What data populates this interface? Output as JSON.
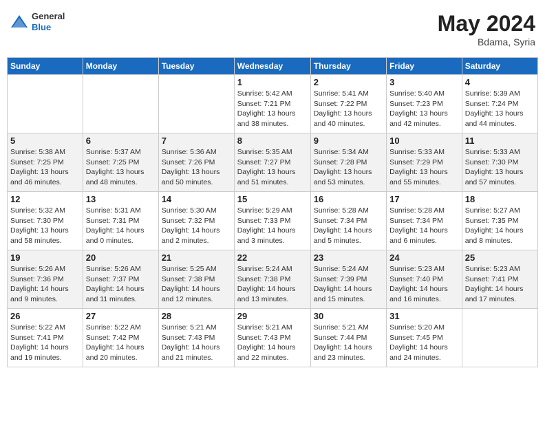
{
  "header": {
    "logo_general": "General",
    "logo_blue": "Blue",
    "title": "May 2024",
    "location": "Bdama, Syria"
  },
  "days_of_week": [
    "Sunday",
    "Monday",
    "Tuesday",
    "Wednesday",
    "Thursday",
    "Friday",
    "Saturday"
  ],
  "weeks": [
    [
      {
        "day": "",
        "info": ""
      },
      {
        "day": "",
        "info": ""
      },
      {
        "day": "",
        "info": ""
      },
      {
        "day": "1",
        "info": "Sunrise: 5:42 AM\nSunset: 7:21 PM\nDaylight: 13 hours\nand 38 minutes."
      },
      {
        "day": "2",
        "info": "Sunrise: 5:41 AM\nSunset: 7:22 PM\nDaylight: 13 hours\nand 40 minutes."
      },
      {
        "day": "3",
        "info": "Sunrise: 5:40 AM\nSunset: 7:23 PM\nDaylight: 13 hours\nand 42 minutes."
      },
      {
        "day": "4",
        "info": "Sunrise: 5:39 AM\nSunset: 7:24 PM\nDaylight: 13 hours\nand 44 minutes."
      }
    ],
    [
      {
        "day": "5",
        "info": "Sunrise: 5:38 AM\nSunset: 7:25 PM\nDaylight: 13 hours\nand 46 minutes."
      },
      {
        "day": "6",
        "info": "Sunrise: 5:37 AM\nSunset: 7:25 PM\nDaylight: 13 hours\nand 48 minutes."
      },
      {
        "day": "7",
        "info": "Sunrise: 5:36 AM\nSunset: 7:26 PM\nDaylight: 13 hours\nand 50 minutes."
      },
      {
        "day": "8",
        "info": "Sunrise: 5:35 AM\nSunset: 7:27 PM\nDaylight: 13 hours\nand 51 minutes."
      },
      {
        "day": "9",
        "info": "Sunrise: 5:34 AM\nSunset: 7:28 PM\nDaylight: 13 hours\nand 53 minutes."
      },
      {
        "day": "10",
        "info": "Sunrise: 5:33 AM\nSunset: 7:29 PM\nDaylight: 13 hours\nand 55 minutes."
      },
      {
        "day": "11",
        "info": "Sunrise: 5:33 AM\nSunset: 7:30 PM\nDaylight: 13 hours\nand 57 minutes."
      }
    ],
    [
      {
        "day": "12",
        "info": "Sunrise: 5:32 AM\nSunset: 7:30 PM\nDaylight: 13 hours\nand 58 minutes."
      },
      {
        "day": "13",
        "info": "Sunrise: 5:31 AM\nSunset: 7:31 PM\nDaylight: 14 hours\nand 0 minutes."
      },
      {
        "day": "14",
        "info": "Sunrise: 5:30 AM\nSunset: 7:32 PM\nDaylight: 14 hours\nand 2 minutes."
      },
      {
        "day": "15",
        "info": "Sunrise: 5:29 AM\nSunset: 7:33 PM\nDaylight: 14 hours\nand 3 minutes."
      },
      {
        "day": "16",
        "info": "Sunrise: 5:28 AM\nSunset: 7:34 PM\nDaylight: 14 hours\nand 5 minutes."
      },
      {
        "day": "17",
        "info": "Sunrise: 5:28 AM\nSunset: 7:34 PM\nDaylight: 14 hours\nand 6 minutes."
      },
      {
        "day": "18",
        "info": "Sunrise: 5:27 AM\nSunset: 7:35 PM\nDaylight: 14 hours\nand 8 minutes."
      }
    ],
    [
      {
        "day": "19",
        "info": "Sunrise: 5:26 AM\nSunset: 7:36 PM\nDaylight: 14 hours\nand 9 minutes."
      },
      {
        "day": "20",
        "info": "Sunrise: 5:26 AM\nSunset: 7:37 PM\nDaylight: 14 hours\nand 11 minutes."
      },
      {
        "day": "21",
        "info": "Sunrise: 5:25 AM\nSunset: 7:38 PM\nDaylight: 14 hours\nand 12 minutes."
      },
      {
        "day": "22",
        "info": "Sunrise: 5:24 AM\nSunset: 7:38 PM\nDaylight: 14 hours\nand 13 minutes."
      },
      {
        "day": "23",
        "info": "Sunrise: 5:24 AM\nSunset: 7:39 PM\nDaylight: 14 hours\nand 15 minutes."
      },
      {
        "day": "24",
        "info": "Sunrise: 5:23 AM\nSunset: 7:40 PM\nDaylight: 14 hours\nand 16 minutes."
      },
      {
        "day": "25",
        "info": "Sunrise: 5:23 AM\nSunset: 7:41 PM\nDaylight: 14 hours\nand 17 minutes."
      }
    ],
    [
      {
        "day": "26",
        "info": "Sunrise: 5:22 AM\nSunset: 7:41 PM\nDaylight: 14 hours\nand 19 minutes."
      },
      {
        "day": "27",
        "info": "Sunrise: 5:22 AM\nSunset: 7:42 PM\nDaylight: 14 hours\nand 20 minutes."
      },
      {
        "day": "28",
        "info": "Sunrise: 5:21 AM\nSunset: 7:43 PM\nDaylight: 14 hours\nand 21 minutes."
      },
      {
        "day": "29",
        "info": "Sunrise: 5:21 AM\nSunset: 7:43 PM\nDaylight: 14 hours\nand 22 minutes."
      },
      {
        "day": "30",
        "info": "Sunrise: 5:21 AM\nSunset: 7:44 PM\nDaylight: 14 hours\nand 23 minutes."
      },
      {
        "day": "31",
        "info": "Sunrise: 5:20 AM\nSunset: 7:45 PM\nDaylight: 14 hours\nand 24 minutes."
      },
      {
        "day": "",
        "info": ""
      }
    ]
  ]
}
